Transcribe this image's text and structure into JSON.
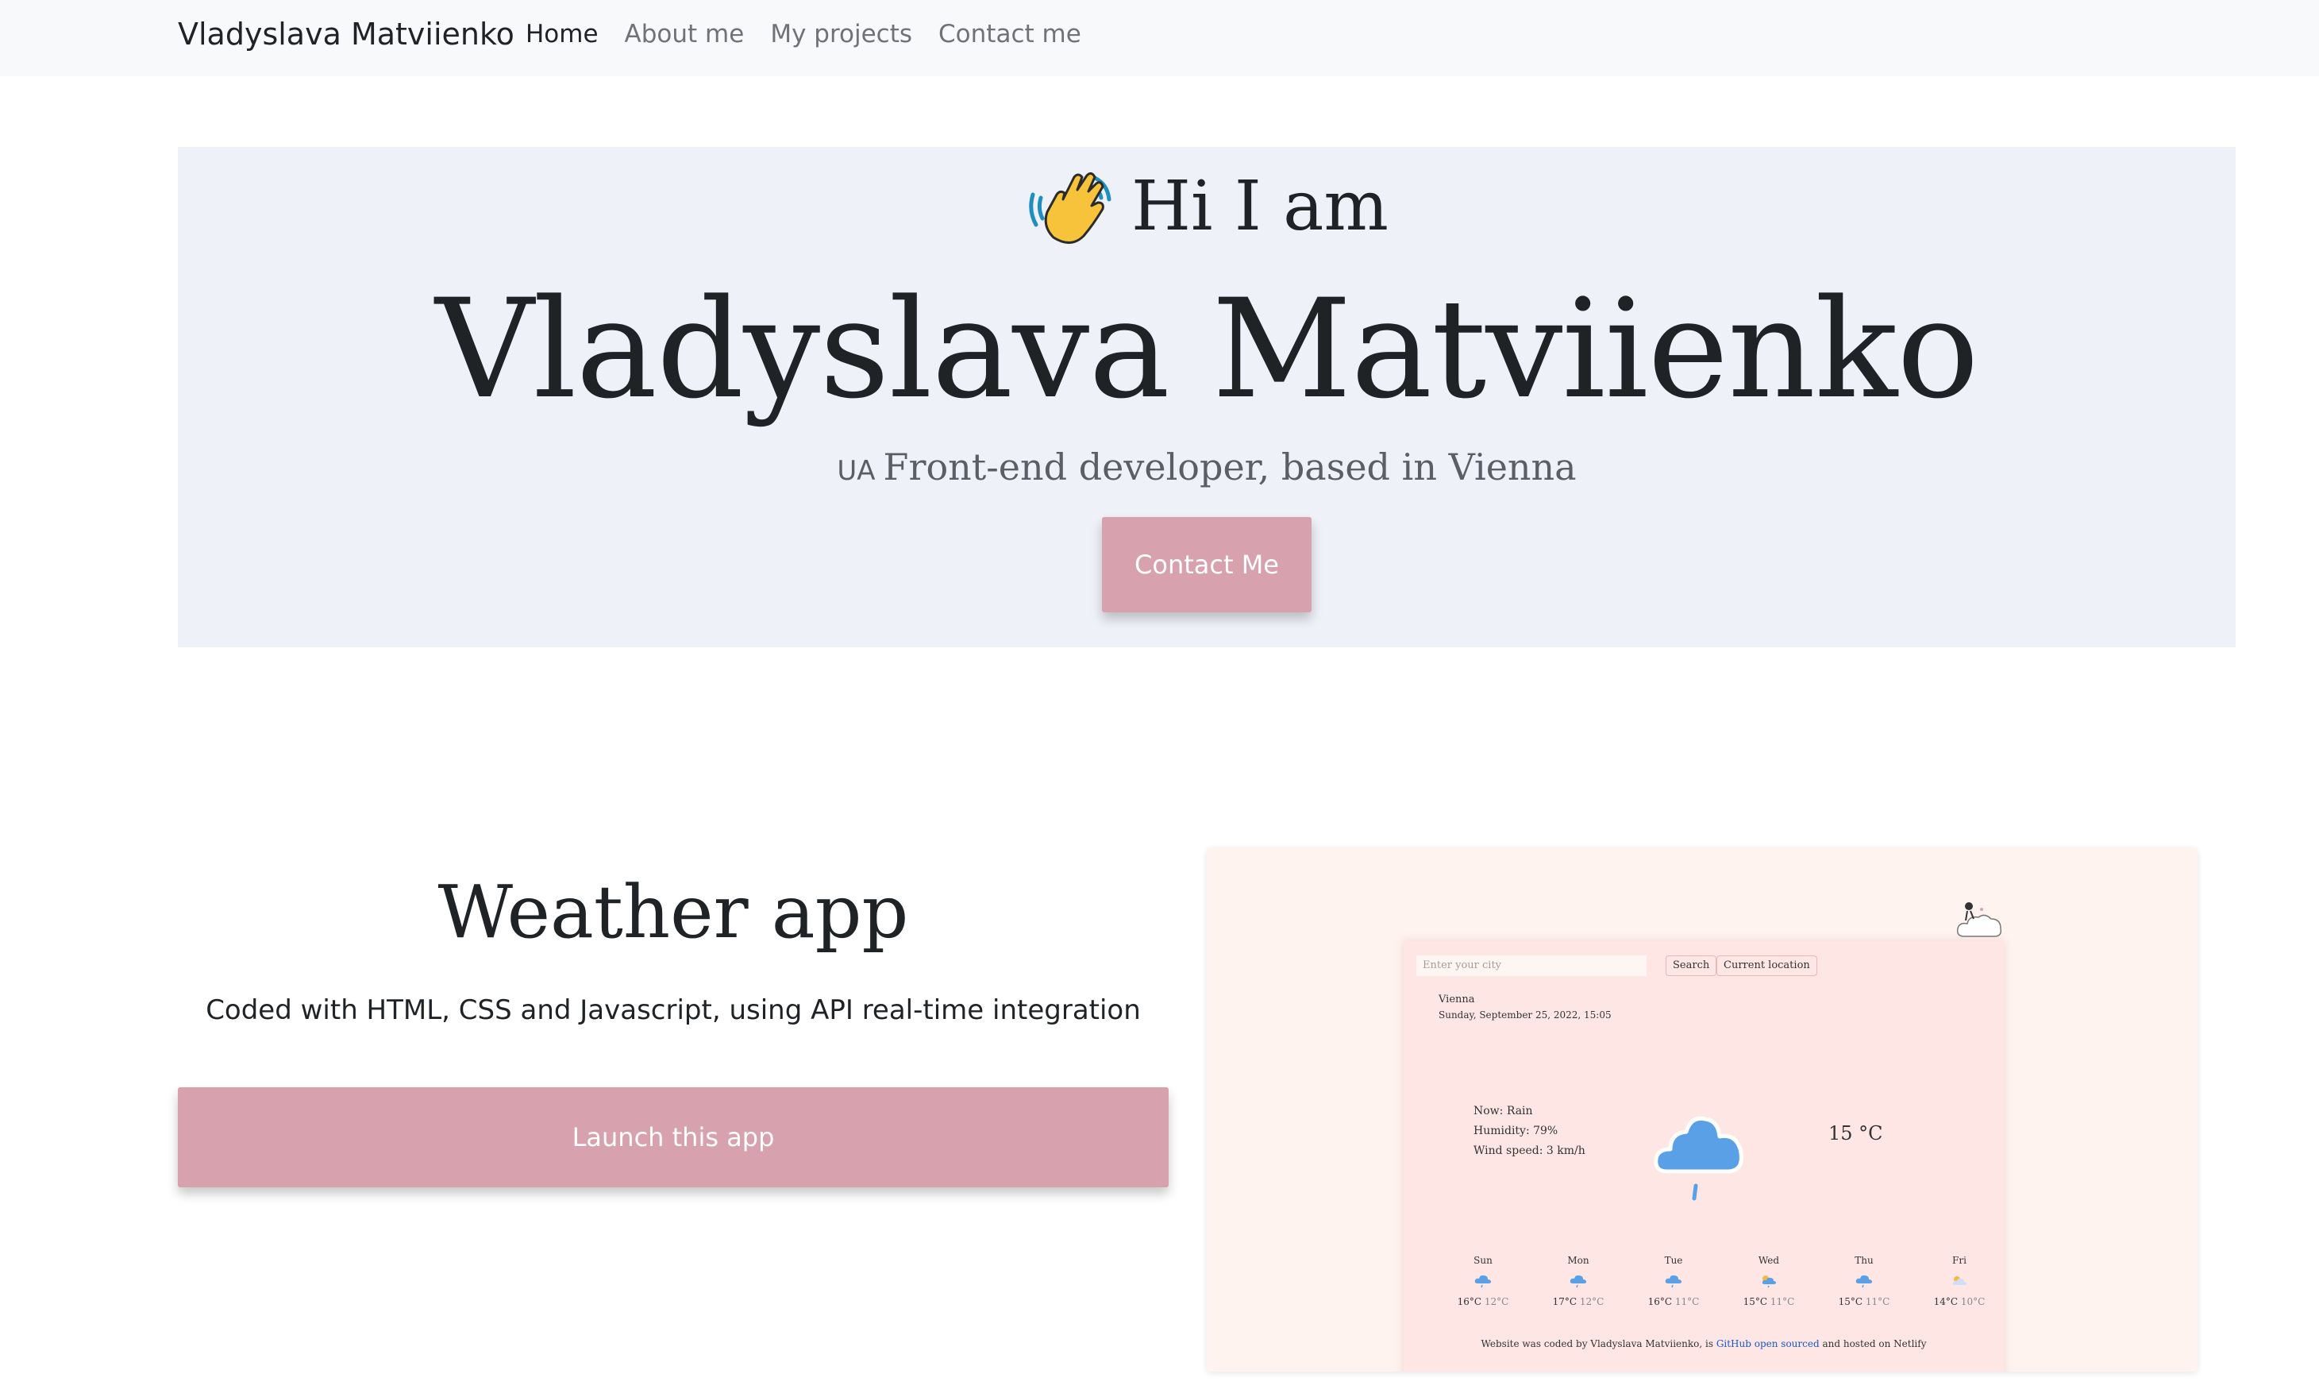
{
  "nav": {
    "brand": "Vladyslava Matviienko",
    "links": [
      "Home",
      "About me",
      "My projects",
      "Contact me"
    ]
  },
  "hero": {
    "greeting": "Hi I am",
    "name": "Vladyslava Matviienko",
    "flag": "UA",
    "subtitle": "Front-end developer, based in Vienna",
    "cta": "Contact Me"
  },
  "project": {
    "title": "Weather app",
    "description": "Coded with HTML, CSS and Javascript, using API real-time integration",
    "launch": "Launch this app"
  },
  "preview": {
    "search_placeholder": "Enter your city",
    "search_btn": "Search",
    "location_btn": "Current location",
    "city": "Vienna",
    "date": "Sunday, September 25, 2022, 15:05",
    "now": "Now: Rain",
    "humidity": "Humidity: 79%",
    "wind": "Wind speed: 3 km/h",
    "temp": "15 °C",
    "forecast": [
      {
        "day": "Sun",
        "max": "16°C",
        "min": "12°C",
        "icon": "rain-icon"
      },
      {
        "day": "Mon",
        "max": "17°C",
        "min": "12°C",
        "icon": "rain-icon"
      },
      {
        "day": "Tue",
        "max": "16°C",
        "min": "11°C",
        "icon": "rain-icon"
      },
      {
        "day": "Wed",
        "max": "15°C",
        "min": "11°C",
        "icon": "sun-cloud-rain-icon"
      },
      {
        "day": "Thu",
        "max": "15°C",
        "min": "11°C",
        "icon": "rain-icon"
      },
      {
        "day": "Fri",
        "max": "14°C",
        "min": "10°C",
        "icon": "sun-cloud-icon"
      }
    ],
    "footer_pre": "Website was coded by Vladyslava Matviienko, is ",
    "footer_link": "GitHub open sourced",
    "footer_post": " and hosted on Netlify"
  },
  "colors": {
    "accent": "#d7a1ad",
    "hero_bg": "#eef1f8",
    "nav_bg": "#f8f9fa",
    "preview_bg": "#fef3ee",
    "card_bg": "#fde6e3",
    "rain_blue": "#5aa0e6"
  }
}
